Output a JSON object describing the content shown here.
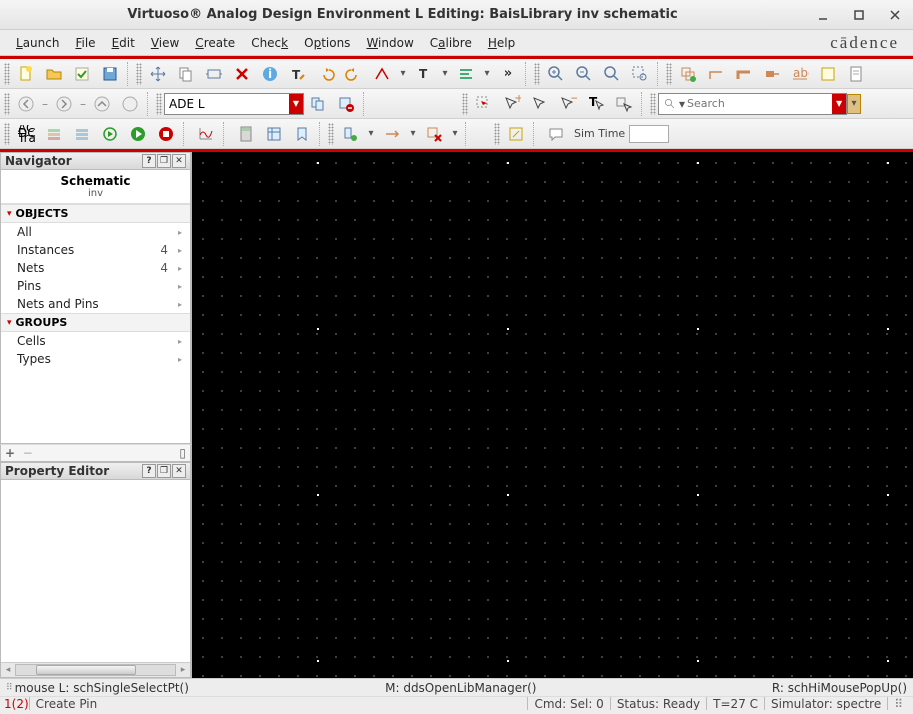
{
  "title": "Virtuoso® Analog Design Environment L Editing: BaisLibrary inv schematic",
  "menu": [
    "Launch",
    "File",
    "Edit",
    "View",
    "Create",
    "Check",
    "Options",
    "Window",
    "Calibre",
    "Help"
  ],
  "brand": "cādence",
  "combo1": "ADE L",
  "search_placeholder": "Search",
  "simtime_label": "Sim Time",
  "navigator": {
    "title": "Navigator",
    "heading": "Schematic",
    "cell": "inv",
    "sect_objects": "OBJECTS",
    "sect_groups": "GROUPS",
    "objects": [
      {
        "label": "All",
        "count": ""
      },
      {
        "label": "Instances",
        "count": "4"
      },
      {
        "label": "Nets",
        "count": "4"
      },
      {
        "label": "Pins",
        "count": ""
      },
      {
        "label": "Nets and Pins",
        "count": ""
      }
    ],
    "groups": [
      {
        "label": "Cells"
      },
      {
        "label": "Types"
      }
    ]
  },
  "prop_title": "Property Editor",
  "status": {
    "left": "mouse L: schSingleSelectPt()",
    "mid": "M: ddsOpenLibManager()",
    "right": "R: schHiMousePopUp()"
  },
  "bottom": {
    "idx": "1(2)",
    "hint": "Create Pin",
    "cmd": "Cmd:   Sel: 0",
    "status": "Status: Ready",
    "temp": "T=27 C",
    "sim": "Simulator: spectre"
  }
}
